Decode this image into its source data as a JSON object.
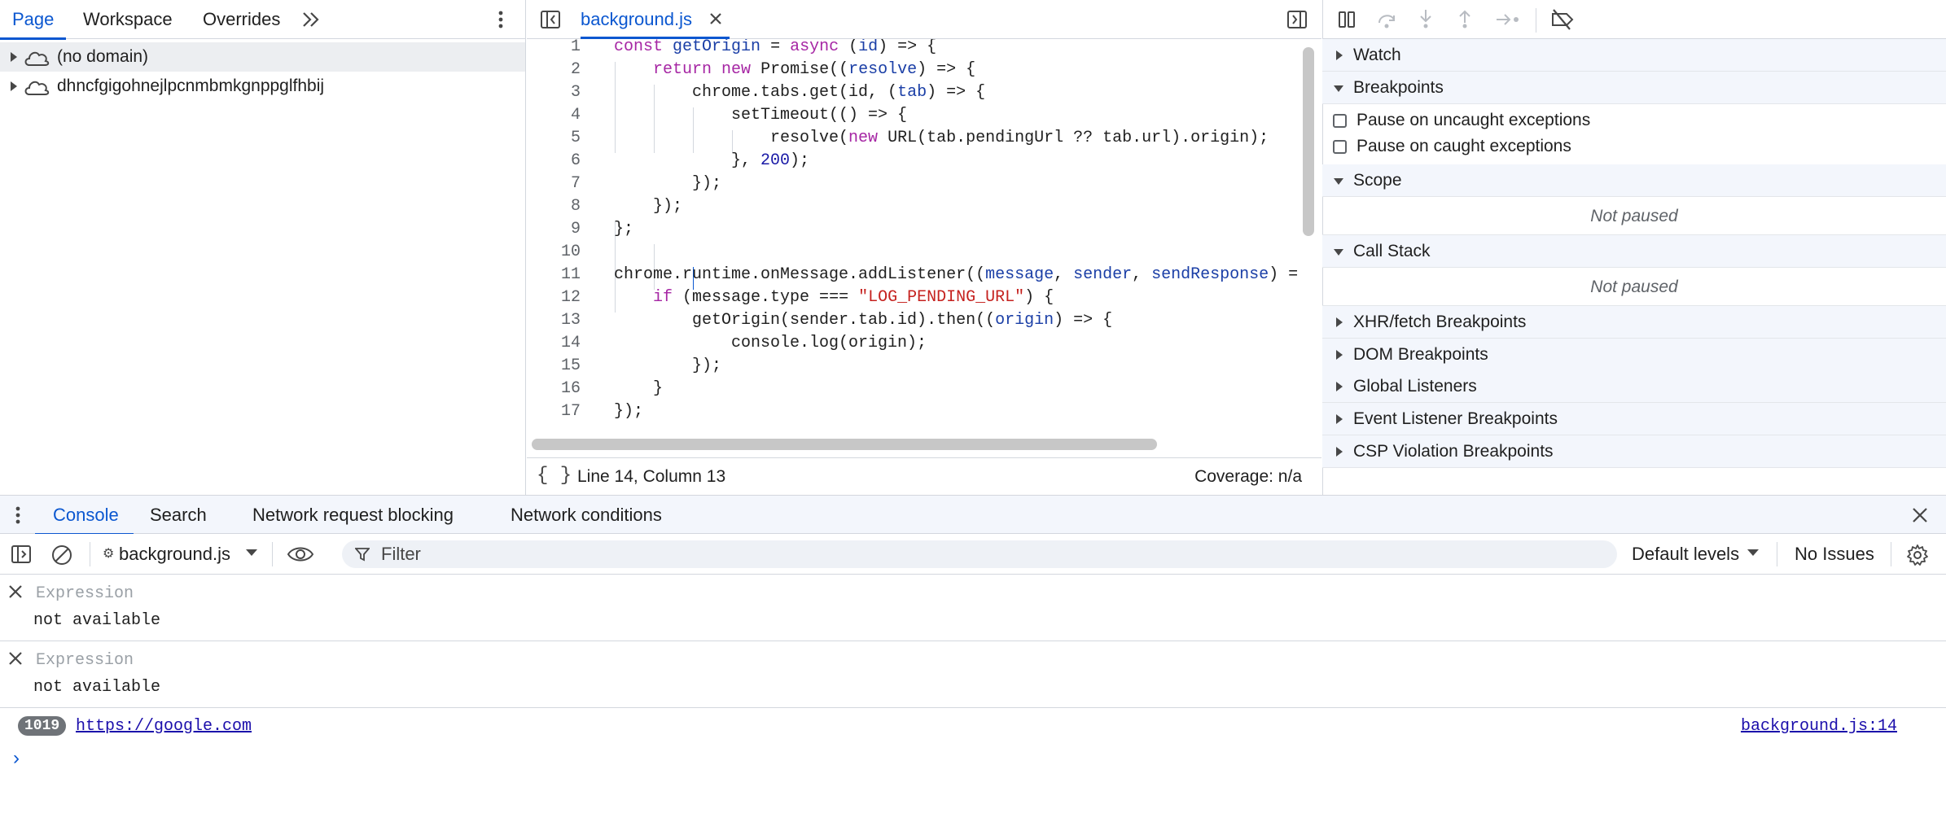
{
  "navigator": {
    "tabs": [
      "Page",
      "Workspace",
      "Overrides"
    ],
    "more_icon": "chevron-double-right-icon",
    "menu_icon": "kebab-menu-icon",
    "tree": [
      {
        "label": "(no domain)",
        "icon": "cloud-icon",
        "selected": true
      },
      {
        "label": "dhncfgigohnejlpcnmbmkgnppglfhbij",
        "icon": "cloud-icon",
        "selected": false
      }
    ]
  },
  "editor": {
    "tab_label": "background.js",
    "close_icon": "close-icon",
    "line_numbers": [
      "1",
      "2",
      "3",
      "4",
      "5",
      "6",
      "7",
      "8",
      "9",
      "10",
      "11",
      "12",
      "13",
      "14",
      "15",
      "16",
      "17"
    ],
    "status": {
      "format_icon": "{ }",
      "position": "Line 14, Column 13",
      "coverage": "Coverage: n/a"
    }
  },
  "debugger": {
    "toolbar_icons": [
      "pause-icon",
      "step-over-icon",
      "step-into-icon",
      "step-out-icon",
      "step-icon",
      "deactivate-breakpoints-icon"
    ],
    "sections": {
      "watch": "Watch",
      "breakpoints": "Breakpoints",
      "pause_uncaught": "Pause on uncaught exceptions",
      "pause_caught": "Pause on caught exceptions",
      "scope": "Scope",
      "scope_status": "Not paused",
      "call_stack": "Call Stack",
      "call_stack_status": "Not paused",
      "xhr": "XHR/fetch Breakpoints",
      "dom": "DOM Breakpoints",
      "global": "Global Listeners",
      "event": "Event Listener Breakpoints",
      "csp": "CSP Violation Breakpoints"
    }
  },
  "drawer": {
    "tabs": [
      "Console",
      "Search",
      "Network request blocking",
      "Network conditions"
    ],
    "close_icon": "close-icon"
  },
  "console": {
    "context": "background.js",
    "filter_placeholder": "Filter",
    "levels": "Default levels",
    "issues": "No Issues",
    "expressions": [
      {
        "placeholder": "Expression",
        "value": "not available"
      },
      {
        "placeholder": "Expression",
        "value": "not available"
      }
    ],
    "log": {
      "count": "1019",
      "text": "https://google.com",
      "source": "background.js:14"
    },
    "prompt": "›"
  },
  "colors": {
    "accent": "#0b57d0",
    "keyword": "#a626a4",
    "string": "#c5221f",
    "number": "#1a1aa6",
    "param": "#1a3ea6",
    "section_bg": "#f3f6fc"
  }
}
